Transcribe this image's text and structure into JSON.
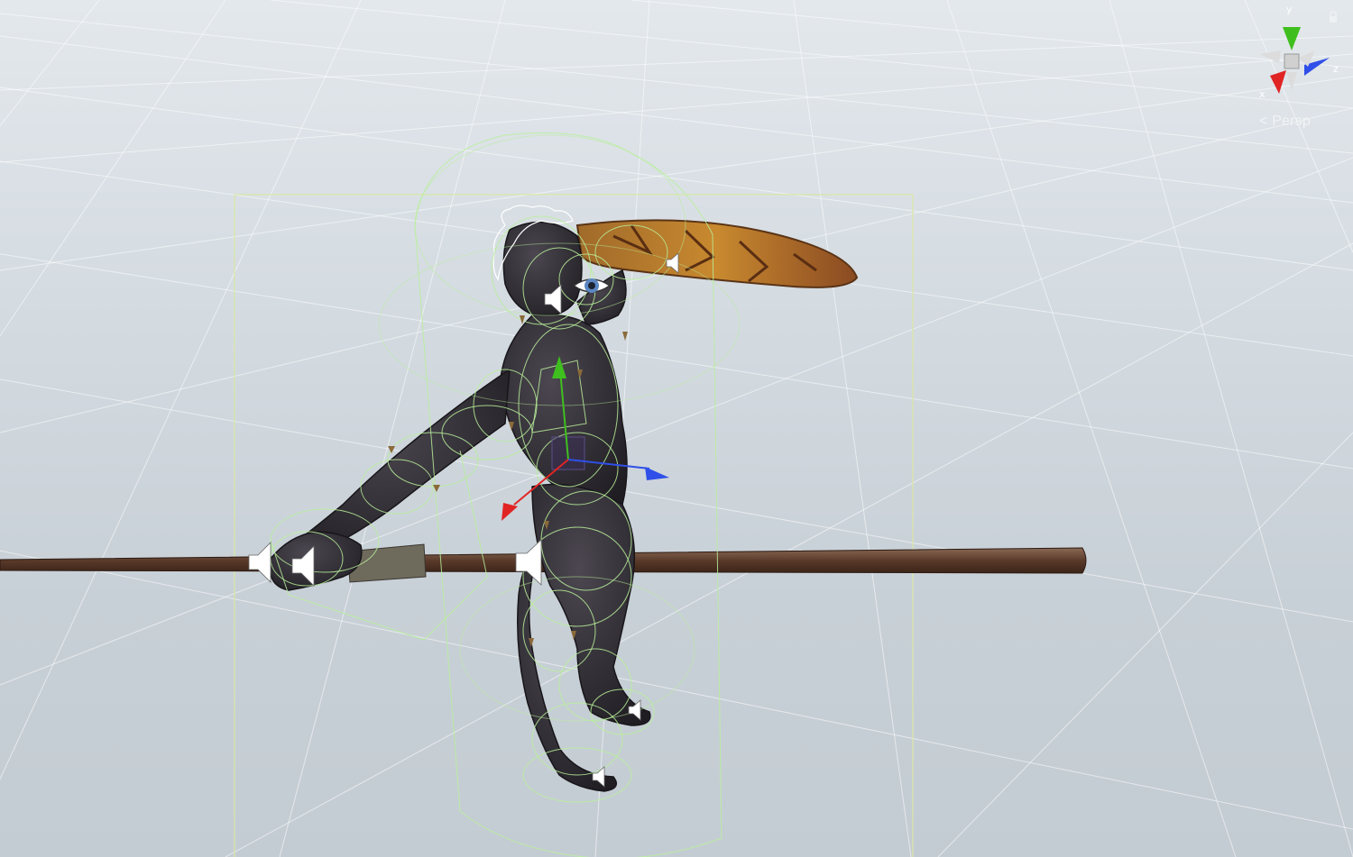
{
  "scene": {
    "projection_label": "< Persp",
    "gizmo": {
      "axis_x": "x",
      "axis_y": "y",
      "axis_z": "z"
    },
    "colors": {
      "axis_x": "#e02424",
      "axis_y": "#3fbf1f",
      "axis_z": "#2f4fe8",
      "collider_wire": "#b9f09a",
      "bounds_box": "#d8e6a8",
      "audio_icon": "#ffffff"
    },
    "icons": {
      "audio_source": "audio-source-icon",
      "eye": "eye-icon",
      "lock": "lock-icon"
    }
  }
}
